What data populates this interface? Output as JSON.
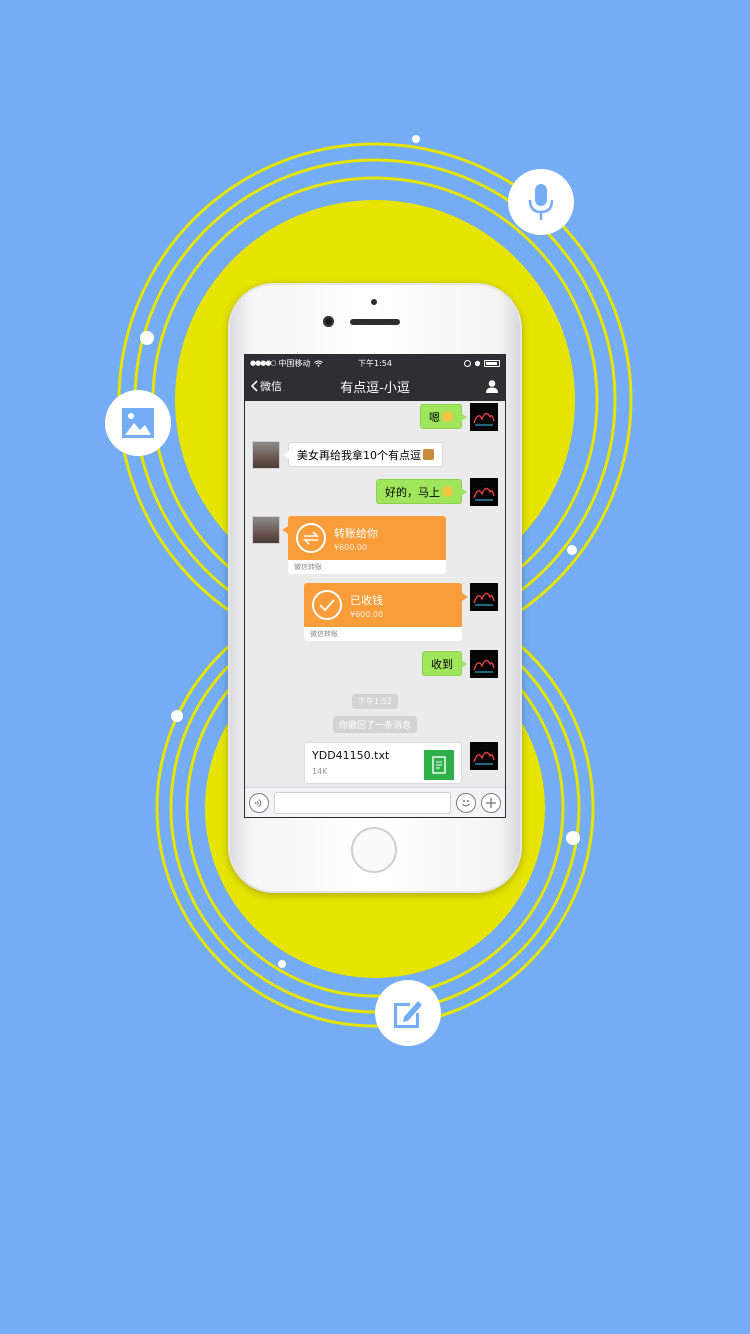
{
  "colors": {
    "background": "#74adf3",
    "circle_fill": "#e6e400",
    "ring_stroke": "#e6e400",
    "bubble_me": "#9fe65c",
    "transfer_orange": "#f99d3a",
    "nav_dark": "#2f2f33",
    "file_green": "#2eb04a"
  },
  "floating_icons": [
    "microphone-icon",
    "image-icon",
    "edit-icon"
  ],
  "status_bar": {
    "carrier": "中国移动",
    "time": "下午1:54"
  },
  "nav": {
    "back_label": "微信",
    "title": "有点逗-小逗"
  },
  "messages": {
    "m1_text": "嗯",
    "m2_text": "美女再给我拿10个有点逗",
    "m3_text": "好的，马上",
    "transfer_sent": {
      "title": "转账给你",
      "amount": "¥600.00",
      "footer": "微信转账"
    },
    "transfer_received": {
      "title": "已收钱",
      "amount": "¥600.00",
      "footer": "微信转账"
    },
    "m6_text": "收到",
    "timestamp": "下午1:52",
    "recall_notice": "你撤回了一条消息",
    "file": {
      "name": "YDD41150.txt",
      "size": "14K"
    }
  }
}
